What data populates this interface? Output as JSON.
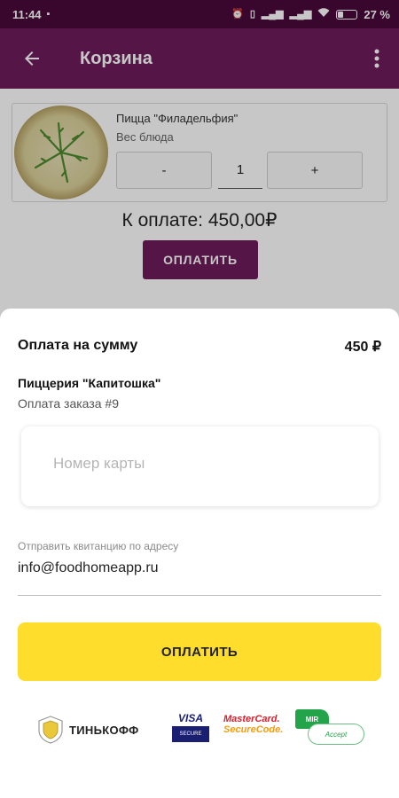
{
  "status_bar": {
    "time": "11:44",
    "battery": "27 %",
    "battery_level": 0.27,
    "icons": [
      "alarm-icon",
      "signal-icon",
      "wifi-icon",
      "battery-icon"
    ]
  },
  "app_bar": {
    "title": "Корзина",
    "back_icon": "arrow-back-icon",
    "menu_icon": "more-vert-icon"
  },
  "cart": {
    "item": {
      "name": "Пицца \"Филадельфия\"",
      "weight_label": "Вес блюда",
      "minus_label": "-",
      "quantity": "1",
      "plus_label": "+"
    },
    "total": "К оплате: 450,00₽",
    "pay_label": "ОПЛАТИТЬ"
  },
  "payment_sheet": {
    "sum_label": "Оплата на сумму",
    "amount": "450 ₽",
    "merchant": "Пиццерия \"Капитошка\"",
    "order": "Оплата заказа #9",
    "card_placeholder": "Номер карты",
    "receipt_label": "Отправить квитанцию по адресу",
    "receipt_email": "info@foodhomeapp.ru",
    "pay_label": "ОПЛАТИТЬ"
  },
  "logos": {
    "tinkoff": "ТИНЬКОФФ",
    "visa_top": "VISA",
    "visa_bottom": "SECURE",
    "mastercard_line1": "MasterCard.",
    "mastercard_line2": "SecureCode.",
    "mir_label": "MIR",
    "mir_accept": "Accept"
  },
  "colors": {
    "status_bar": "#4a0a3a",
    "primary": "#6d1b5c",
    "pay_button": "#ffdd2d"
  }
}
